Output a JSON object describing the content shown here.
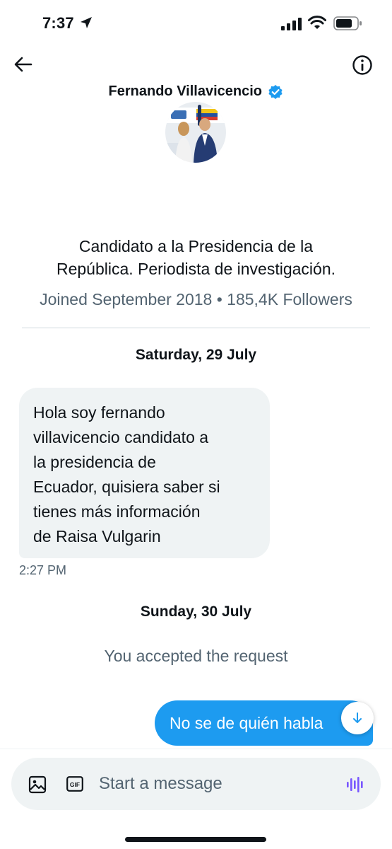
{
  "status_bar": {
    "time": "7:37"
  },
  "profile": {
    "name": "Fernando Villavicencio",
    "bio_line1": "Candidato a la Presidencia de la",
    "bio_line2": "República. Periodista de investigación.",
    "meta": "Joined September 2018 • 185,4K Followers"
  },
  "conversation": {
    "date_1": "Saturday, 29 July",
    "incoming_lines": [
      "Hola soy fernando",
      "villavicencio candidato a",
      "la presidencia de",
      "Ecuador, quisiera saber si",
      "tienes más información",
      "de Raisa Vulgarin"
    ],
    "incoming_time": "2:27 PM",
    "date_2": "Sunday, 30 July",
    "system_note": "You accepted the request",
    "outgoing_text": "No se de quién habla"
  },
  "composer": {
    "placeholder": "Start a message",
    "gif_label": "GIF"
  },
  "colors": {
    "accent": "#1d9bf0",
    "voice": "#7856ff",
    "muted_text": "#536471",
    "bubble_in": "#eff3f4"
  }
}
